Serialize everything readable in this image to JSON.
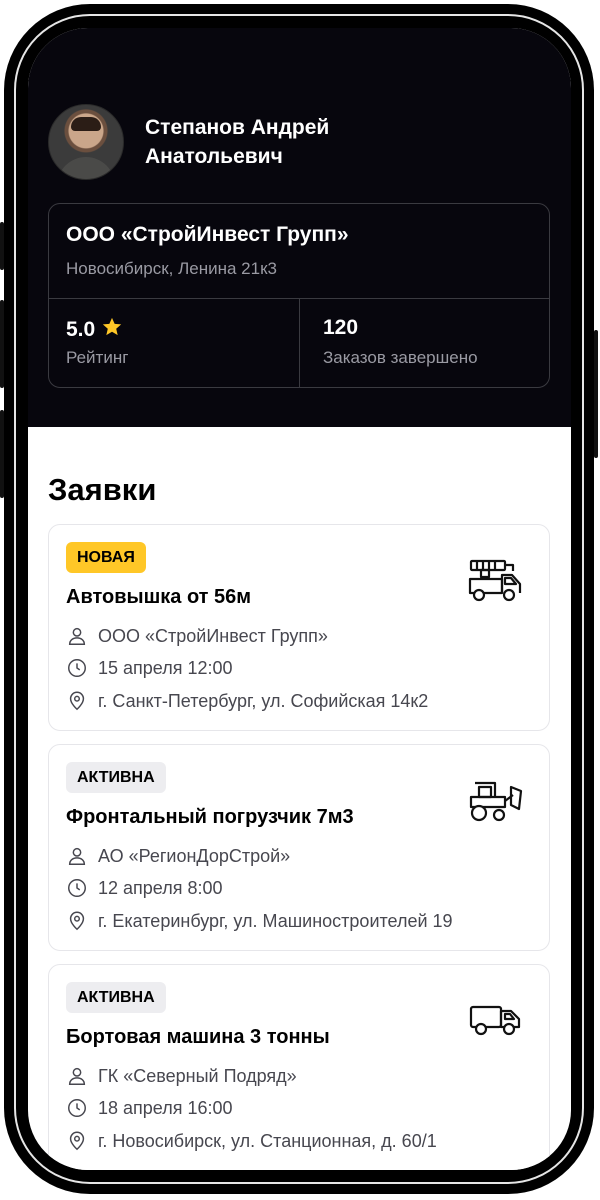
{
  "profile": {
    "name": "Степанов Андрей\nАнатольевич",
    "company": "ООО «СтройИнвест Групп»",
    "address": "Новосибирск, Ленина 21к3",
    "rating_value": "5.0",
    "rating_label": "Рейтинг",
    "orders_value": "120",
    "orders_label": "Заказов завершено"
  },
  "section_title": "Заявки",
  "colors": {
    "accent": "#ffc727",
    "dark_bg": "#07060d",
    "muted": "#9a9aa3"
  },
  "orders": [
    {
      "status": "НОВАЯ",
      "title": "Автовышка от 56м",
      "customer": "ООО «СтройИнвест Групп»",
      "date": "15 апреля 12:00",
      "address": "г. Санкт-Петербург, ул. Софийская 14к2",
      "icon": "aerial-lift-truck-icon"
    },
    {
      "status": "АКТИВНА",
      "title": "Фронтальный погрузчик 7м3",
      "customer": "АО «РегионДорСтрой»",
      "date": "12 апреля 8:00",
      "address": "г. Екатеринбург, ул. Машиностроителей 19",
      "icon": "front-loader-icon"
    },
    {
      "status": "АКТИВНА",
      "title": "Бортовая машина 3 тонны",
      "customer": "ГК «Северный Подряд»",
      "date": "18 апреля 16:00",
      "address": "г. Новосибирск, ул. Станционная, д. 60/1",
      "icon": "flatbed-truck-icon"
    }
  ]
}
